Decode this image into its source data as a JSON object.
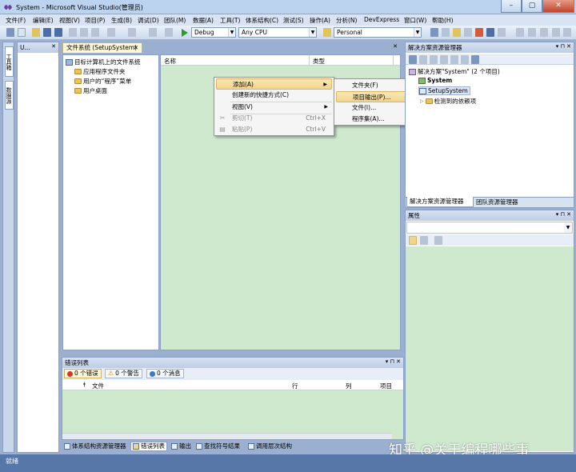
{
  "window": {
    "title": "System - Microsoft Visual Studio(管理员)",
    "minimize": "–",
    "maximize": "▢",
    "close": "✕"
  },
  "menu": [
    "文件(F)",
    "编辑(E)",
    "视图(V)",
    "项目(P)",
    "生成(B)",
    "调试(D)",
    "团队(M)",
    "数据(A)",
    "工具(T)",
    "体系结构(C)",
    "测试(S)",
    "操作(A)",
    "分析(N)",
    "DevExpress",
    "窗口(W)",
    "帮助(H)"
  ],
  "toolbar": {
    "config": "Debug",
    "platform": "Any CPU",
    "profile": "Personal",
    "dropdown_arrow": "▼"
  },
  "left_strip": {
    "toolbox": "工具箱",
    "datasource": "数据源"
  },
  "u_panel": {
    "title": "U..."
  },
  "fs_tab": {
    "label": "文件系统 (SetupSystem)",
    "close": "✕"
  },
  "fs_tree": {
    "root": "目标计算机上的文件系统",
    "items": [
      "应用程序文件夹",
      "用户的“程序”菜单",
      "用户桌面"
    ]
  },
  "fs_list": {
    "col_name": "名称",
    "col_type": "类型"
  },
  "context_menu": {
    "items": [
      {
        "label": "添加(A)",
        "shortcut": "",
        "submenu": "▶"
      },
      {
        "label": "创建新的快捷方式(C)",
        "shortcut": ""
      },
      {
        "label": "视图(V)",
        "shortcut": "",
        "submenu": "▶"
      },
      {
        "label": "剪切(T)",
        "shortcut": "Ctrl+X",
        "icon": "✂"
      },
      {
        "label": "粘贴(P)",
        "shortcut": "Ctrl+V",
        "icon": "▤"
      }
    ]
  },
  "submenu": {
    "items": [
      "文件夹(F)",
      "项目输出(P)...",
      "文件(I)...",
      "程序集(A)..."
    ]
  },
  "solution_explorer": {
    "title": "解决方案资源管理器",
    "solution": "解决方案\"System\" (2 个项目)",
    "project1": "System",
    "project2": "SetupSystem",
    "deps": "检测到的依赖项",
    "tab1": "解决方案资源管理器",
    "tab2": "团队资源管理器"
  },
  "properties": {
    "title": "属性"
  },
  "panel_controls": {
    "pin": "▾ ⊓ ✕"
  },
  "error_list": {
    "title": "错误列表",
    "errors": "0 个错误",
    "warnings": "0 个警告",
    "messages": "0 个消息",
    "cols": [
      "文件",
      "行",
      "列",
      "项目"
    ]
  },
  "bottom_tabs": [
    "体系结构资源管理器",
    "错误列表",
    "输出",
    "查找符号结果",
    "调用层次结构"
  ],
  "status": "就绪",
  "watermark": "知乎 @关于编程哪些事"
}
